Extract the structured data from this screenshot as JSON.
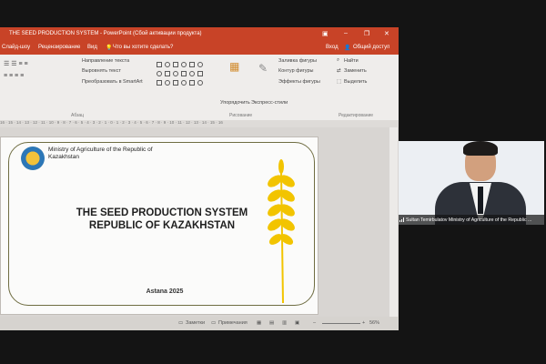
{
  "window": {
    "title": "THE SEED PRODUCTION SYSTEM - PowerPoint (Сбой активации продукта)"
  },
  "tabs": {
    "show": "Слайд-шоу",
    "review": "Рецензирование",
    "view": "Вид",
    "tell_me": "Что вы хотите сделать?",
    "signin": "Вход",
    "share": "Общий доступ"
  },
  "ribbon": {
    "text_direction": "Направление текста",
    "align_text": "Выровнять текст",
    "smartart": "Преобразовать в SmartArt",
    "paragraph_group": "Абзац",
    "arrange": "Упорядочить",
    "quick_styles": "Экспресс-стили",
    "shape_fill": "Заливка фигуры",
    "shape_outline": "Контур фигуры",
    "shape_effects": "Эффекты фигуры",
    "drawing_group": "Рисование",
    "find": "Найти",
    "replace": "Заменить",
    "select": "Выделить",
    "editing_group": "Редактирование"
  },
  "ruler": {
    "marks": "16 · 15 · 14 · 13 · 12 · 11 · 10 · 9 · 8 · 7 · 6 · 5 · 4 · 3 · 2 · 1 · 0 · 1 · 2 · 3 · 4 · 5 · 6 · 7 · 8 · 9 · 10 · 11 · 12 · 13 · 14 · 15 · 16"
  },
  "slide": {
    "ministry": "Ministry of Agriculture of the Republic of Kazakhstan",
    "title_line1": "THE SEED PRODUCTION SYSTEM",
    "title_line2": "REPUBLIC OF KAZAKHSTAN",
    "city_year": "Astana 2025"
  },
  "status": {
    "notes": "Заметки",
    "comments": "Примечания",
    "zoom": "56%"
  },
  "video": {
    "participant": "Sultan Temirbulatov Ministry of Agriculture of the Republic ..."
  },
  "colors": {
    "ppt_accent": "#c84327",
    "frame": "#6f6d42",
    "wheat": "#f2c400"
  }
}
